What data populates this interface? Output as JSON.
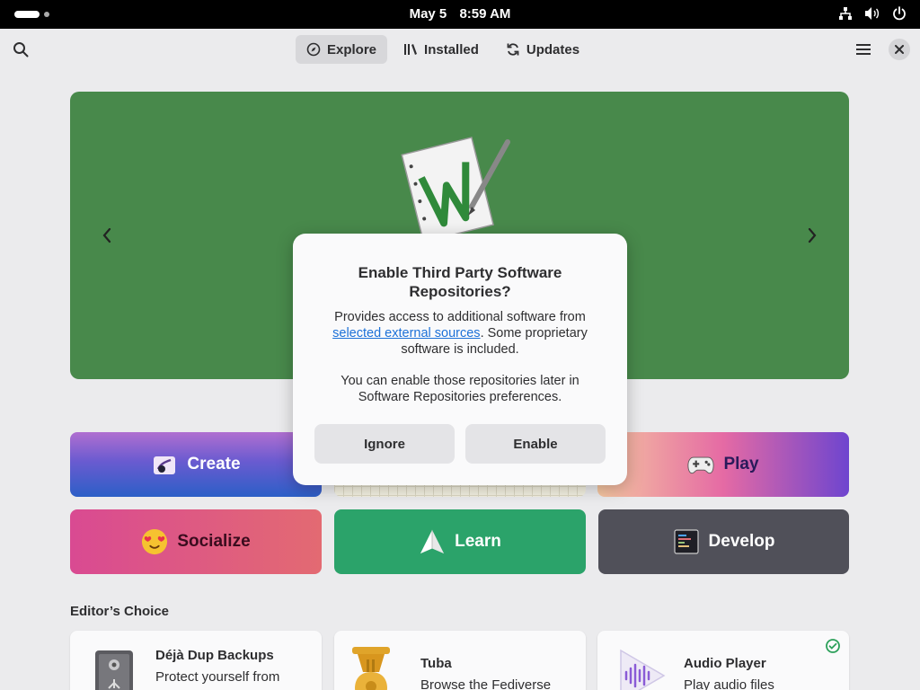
{
  "system_bar": {
    "date": "May 5",
    "time": "8:59 AM",
    "icons": [
      "activities-pill",
      "network-icon",
      "volume-icon",
      "power-icon"
    ]
  },
  "header": {
    "tabs": [
      {
        "label": "Explore",
        "icon": "compass-icon",
        "active": true
      },
      {
        "label": "Installed",
        "icon": "library-icon",
        "active": false
      },
      {
        "label": "Updates",
        "icon": "refresh-icon",
        "active": false
      }
    ],
    "icons": [
      "search-icon",
      "menu-icon",
      "close-icon"
    ]
  },
  "banner": {
    "color": "#48894b",
    "featured_icon": "writer-icon"
  },
  "categories": [
    {
      "label": "Create",
      "icon": "create-icon"
    },
    {
      "label": "",
      "icon": ""
    },
    {
      "label": "Play",
      "icon": "gamepad-icon"
    },
    {
      "label": "Socialize",
      "icon": "emoji-icon"
    },
    {
      "label": "Learn",
      "icon": "paper-plane-icon"
    },
    {
      "label": "Develop",
      "icon": "terminal-icon"
    }
  ],
  "editors_choice": {
    "title": "Editor’s Choice",
    "apps": [
      {
        "name": "Déjà Dup Backups",
        "description": "Protect yourself from",
        "icon": "vault-icon"
      },
      {
        "name": "Tuba",
        "description": "Browse the Fediverse",
        "icon": "tuba-icon"
      },
      {
        "name": "Audio Player",
        "description": "Play audio files",
        "icon": "audio-player-icon",
        "installed": true
      }
    ]
  },
  "dialog": {
    "title": "Enable Third Party Software Repositories?",
    "body_pre": "Provides access to additional software from ",
    "body_link": "selected external sources",
    "body_post": ". Some proprietary software is included.",
    "body2": "You can enable those repositories later in Software Repositories preferences.",
    "ignore_label": "Ignore",
    "enable_label": "Enable"
  }
}
